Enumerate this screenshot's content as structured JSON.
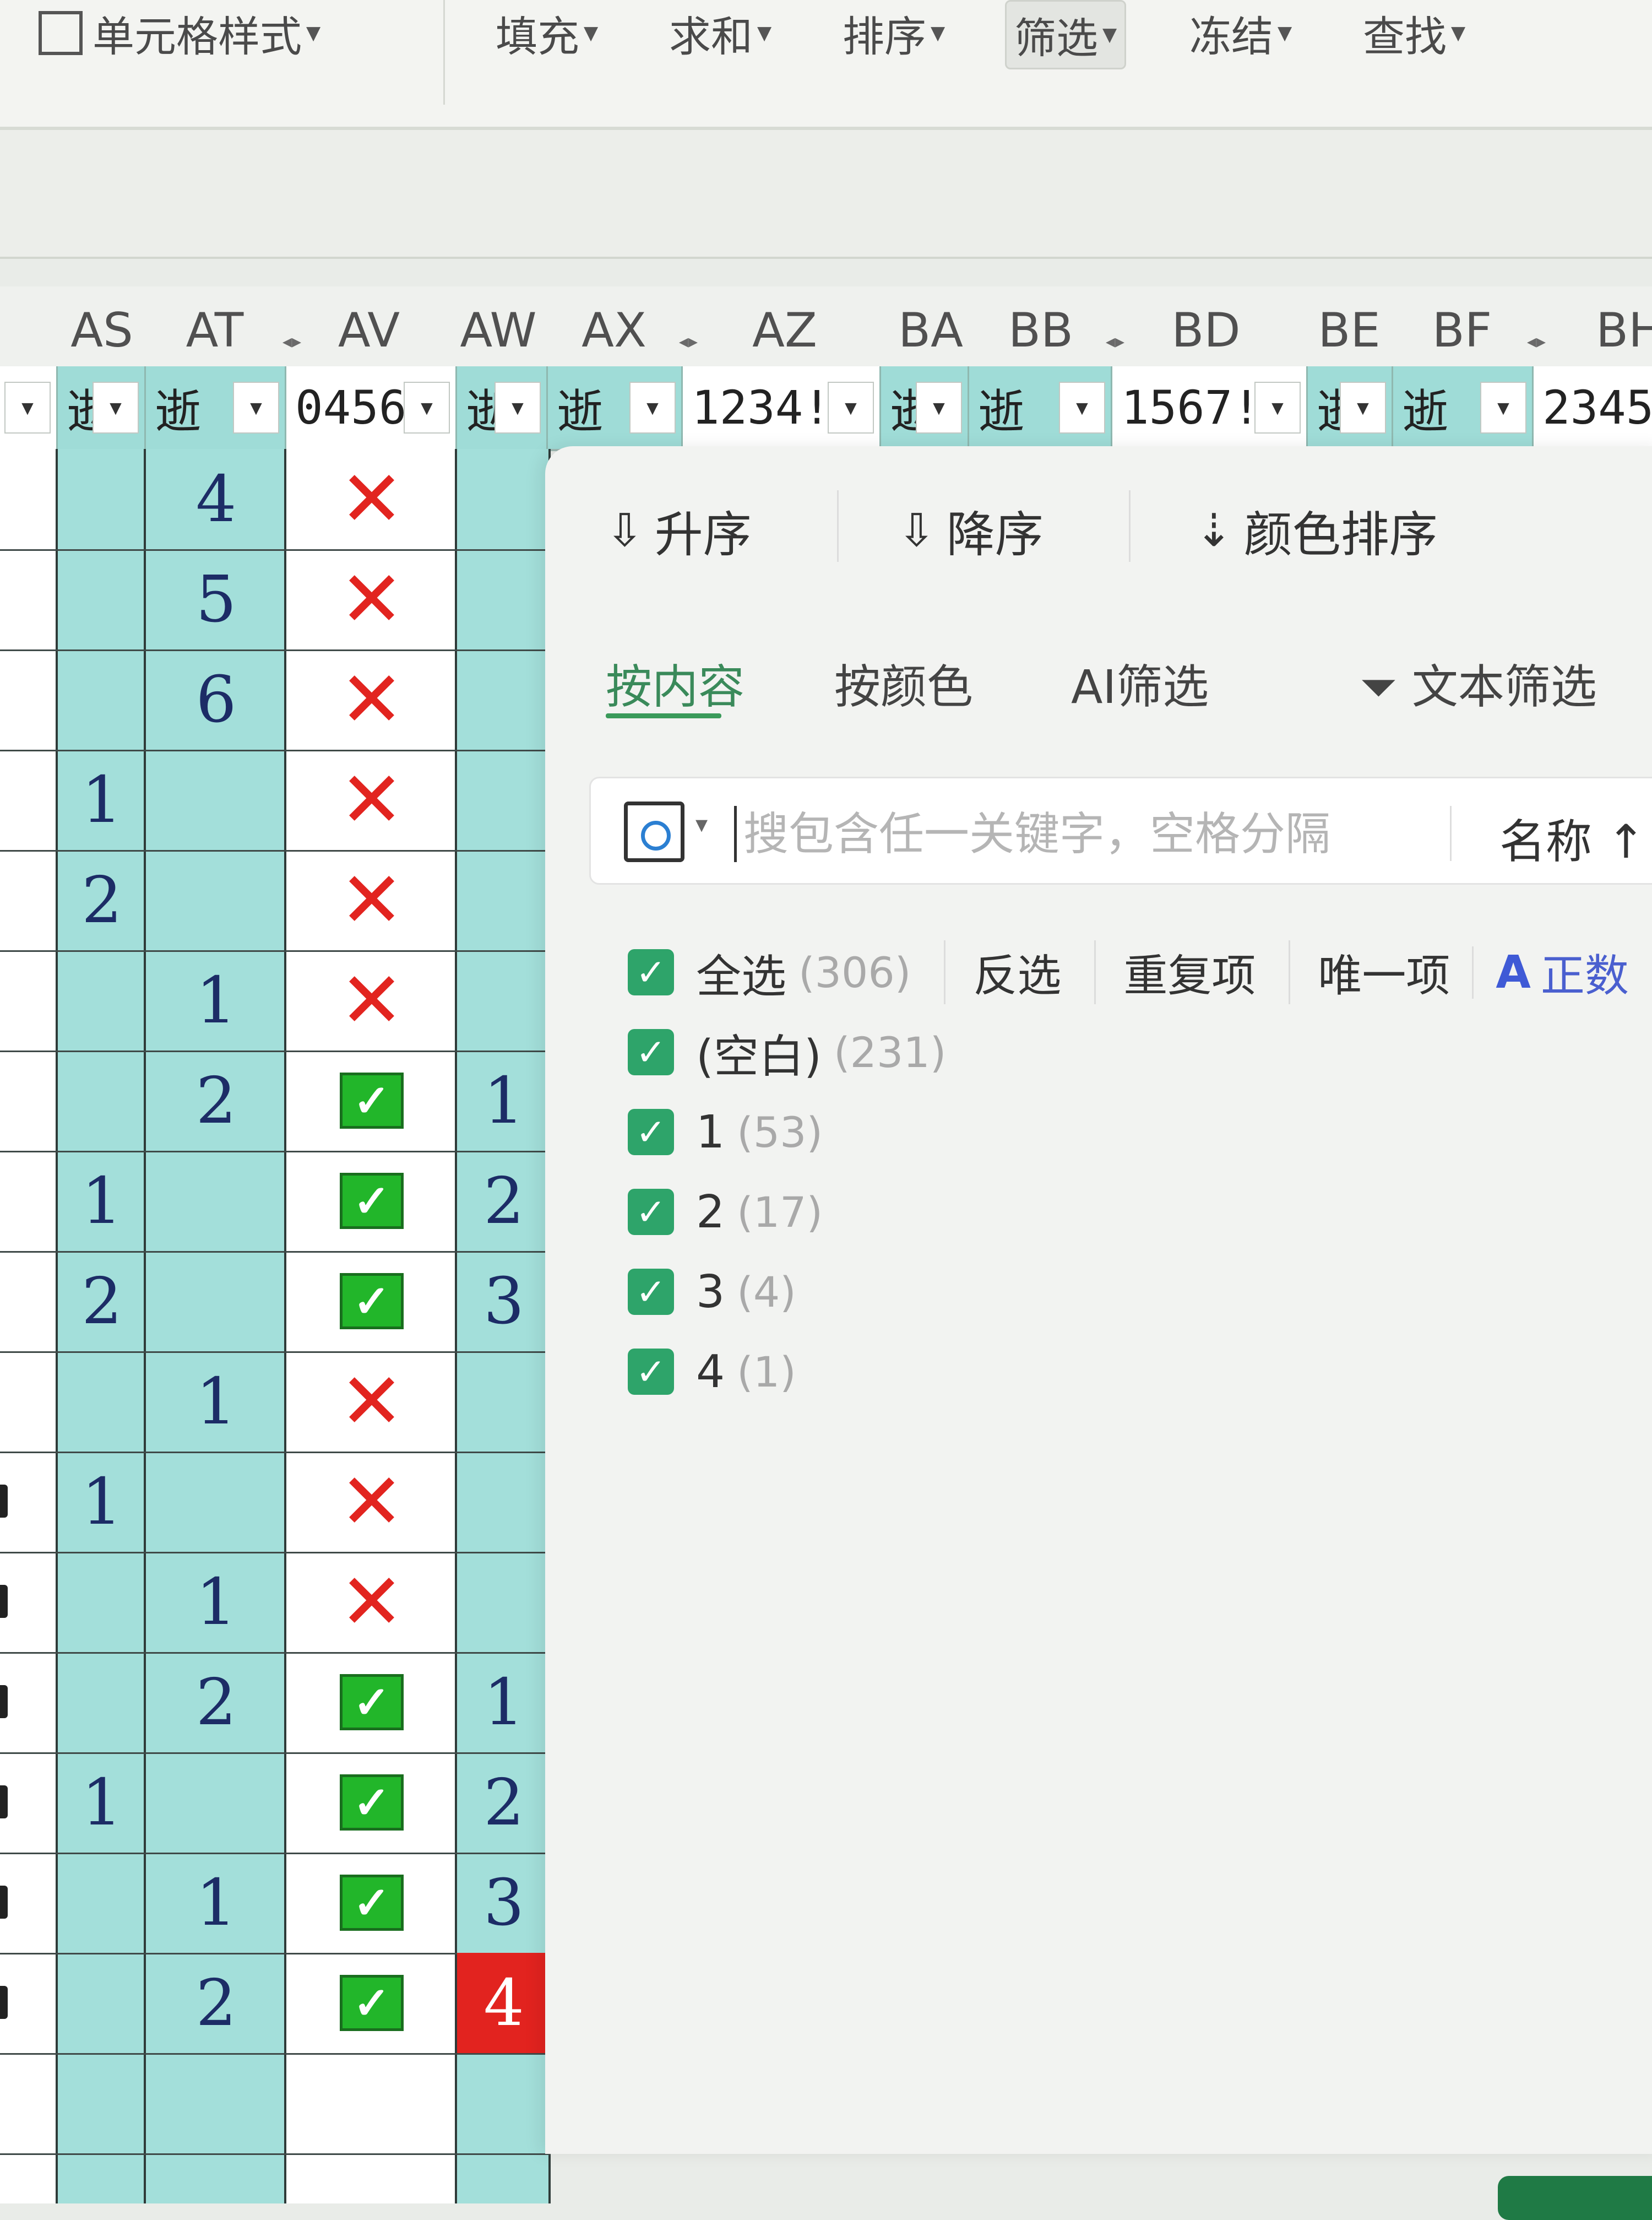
{
  "toolbar": {
    "cell_style": "单元格样式",
    "fill": "填充",
    "sum": "求和",
    "sort": "排序",
    "filter": "筛选",
    "freeze": "冻结",
    "find": "查找"
  },
  "columns": [
    "AS",
    "AT",
    "AV",
    "AW",
    "AX",
    "AZ",
    "BA",
    "BB",
    "BD",
    "BE",
    "BF",
    "BH"
  ],
  "filter_row": [
    "逝",
    "逝",
    "0456",
    "逝",
    "逝",
    "1234!",
    "逝",
    "逝",
    "1567!",
    "逝",
    "逝",
    "2345"
  ],
  "grid_rows": [
    {
      "as": "",
      "at": "4",
      "av": "x",
      "aw": ""
    },
    {
      "as": "",
      "at": "5",
      "av": "x",
      "aw": ""
    },
    {
      "as": "",
      "at": "6",
      "av": "x",
      "aw": ""
    },
    {
      "as": "1",
      "at": "",
      "av": "x",
      "aw": ""
    },
    {
      "as": "2",
      "at": "",
      "av": "x",
      "aw": ""
    },
    {
      "as": "",
      "at": "1",
      "av": "x",
      "aw": ""
    },
    {
      "as": "",
      "at": "2",
      "av": "check",
      "aw": "1"
    },
    {
      "as": "1",
      "at": "",
      "av": "check",
      "aw": "2"
    },
    {
      "as": "2",
      "at": "",
      "av": "check",
      "aw": "3"
    },
    {
      "as": "",
      "at": "1",
      "av": "x",
      "aw": ""
    },
    {
      "as": "1",
      "at": "",
      "av": "x",
      "aw": ""
    },
    {
      "as": "",
      "at": "1",
      "av": "x",
      "aw": ""
    },
    {
      "as": "",
      "at": "2",
      "av": "check",
      "aw": "1"
    },
    {
      "as": "1",
      "at": "",
      "av": "check",
      "aw": "2"
    },
    {
      "as": "",
      "at": "1",
      "av": "check",
      "aw": "3"
    },
    {
      "as": "",
      "at": "2",
      "av": "check",
      "aw": "4",
      "aw_highlight": true
    },
    {
      "as": "",
      "at": "",
      "av": "",
      "aw": ""
    }
  ],
  "panel": {
    "sort_asc": "升序",
    "sort_desc": "降序",
    "sort_color": "颜色排序",
    "tabs": [
      "按内容",
      "按颜色",
      "AI筛选",
      "文本筛选"
    ],
    "search_placeholder": "搜包含任一关键字，空格分隔",
    "name_sort": "名称 ↑",
    "select_all": {
      "label": "全选",
      "count": "(306)"
    },
    "actions": [
      "反选",
      "重复项",
      "唯一项"
    ],
    "ai_label": "正数",
    "items": [
      {
        "label": "(空白)",
        "count": "(231)"
      },
      {
        "label": "1",
        "count": "(53)"
      },
      {
        "label": "2",
        "count": "(17)"
      },
      {
        "label": "3",
        "count": "(4)"
      },
      {
        "label": "4",
        "count": "(1)"
      }
    ]
  },
  "colors": {
    "teal": "#a3dfda",
    "cross_red": "#e2241f",
    "check_green": "#22b62a",
    "highlight_red": "#e2231f",
    "panel_checkbox": "#2ea46a",
    "ai_blue": "#3f5ad6"
  },
  "icons": {
    "cross": "✕",
    "check": "✓",
    "caret": "▾",
    "sort_asc": "⇩",
    "sort_desc": "⇩",
    "sort_color": "⇣",
    "text_filter": "⏷",
    "ai": "A"
  }
}
